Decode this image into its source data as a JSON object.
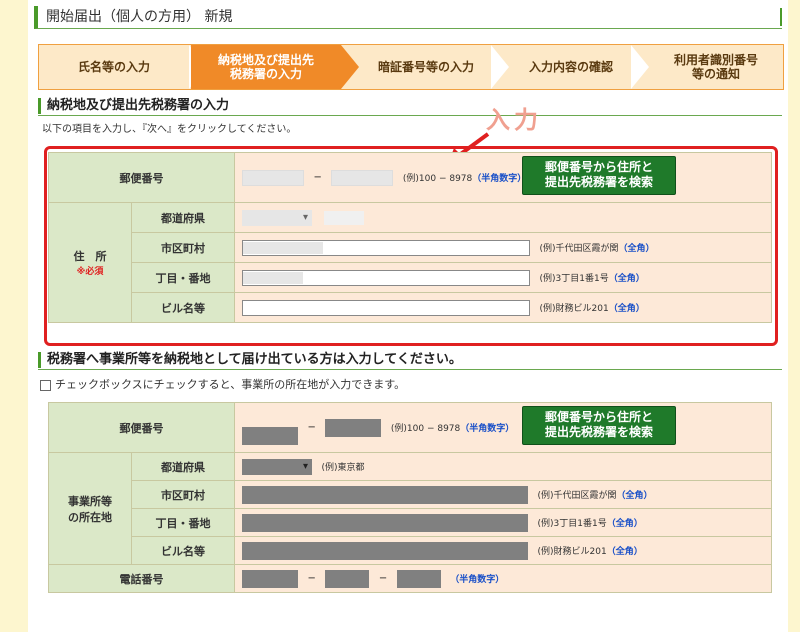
{
  "title": "開始届出（個人の方用） 新規",
  "steps": [
    "氏名等の入力",
    "納税地及び提出先\n税務署の入力",
    "暗証番号等の入力",
    "入力内容の確認",
    "利用者識別番号\n等の通知"
  ],
  "section1": {
    "heading": "納税地及び提出先税務署の入力",
    "instruction": "以下の項目を入力し、『次へ』をクリックしてください。",
    "annotation": "入力",
    "postal_label": "郵便番号",
    "postal_example": "(例)100 − 8978",
    "postal_hint": "（半角数字）",
    "search_button": "郵便番号から住所と\n提出先税務署を検索",
    "address_label": "住　所",
    "required": "※必須",
    "rows": [
      {
        "label": "都道府県",
        "example": "",
        "hint": ""
      },
      {
        "label": "市区町村",
        "example": "(例)千代田区霞が関",
        "hint": "（全角）"
      },
      {
        "label": "丁目・番地",
        "example": "(例)3丁目1番1号",
        "hint": "（全角）"
      },
      {
        "label": "ビル名等",
        "example": "(例)財務ビル201",
        "hint": "（全角）"
      }
    ]
  },
  "section2": {
    "heading": "税務署へ事業所等を納税地として届け出ている方は入力してください。",
    "checkbox_text": "チェックボックスにチェックすると、事業所の所在地が入力できます。",
    "postal_label": "郵便番号",
    "postal_example": "(例)100 − 8978",
    "postal_hint": "（半角数字）",
    "search_button": "郵便番号から住所と\n提出先税務署を検索",
    "address_label": "事業所等\nの所在地",
    "rows": [
      {
        "label": "都道府県",
        "example": "(例)東京都",
        "hint": ""
      },
      {
        "label": "市区町村",
        "example": "(例)千代田区霞が関",
        "hint": "（全角）"
      },
      {
        "label": "丁目・番地",
        "example": "(例)3丁目1番1号",
        "hint": "（全角）"
      },
      {
        "label": "ビル名等",
        "example": "(例)財務ビル201",
        "hint": "（全角）"
      }
    ],
    "phone_label": "電話番号",
    "phone_hint": "（半角数字）"
  }
}
